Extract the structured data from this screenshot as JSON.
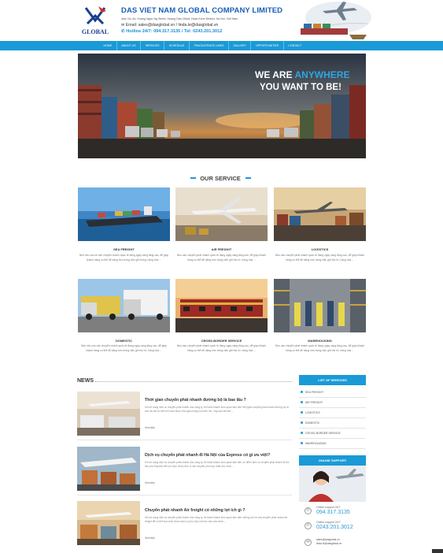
{
  "header": {
    "company_name": "DAS VIET NAM GLOBAL COMPANY LIMITED",
    "address": "Add: No 4A, Hoang Ngoc Ng Street, Hoang Dieu Ward, Hoan Kiem District, Ha Noi, Viet Nam",
    "email_line": "Email: sales@dasglobal.vn / linda.le@dasglobal.vn",
    "hotline_line": "Hotline 24/7: 094.317.3135 / Tel: 0243.201.3012",
    "logo_text": "GLOBAL"
  },
  "nav": {
    "items": [
      "HOME",
      "ABOUT US",
      "SERVICES",
      "SCHEDULE",
      "TRACK&TRACE LINKS",
      "GALLERY",
      "OPPORTUNITIES",
      "CONTACT"
    ]
  },
  "banner": {
    "line1_pre": "WE ARE ",
    "line1_hl": "ANYWHERE",
    "line2": "YOU WANT TO BE!"
  },
  "services": {
    "title": "OUR SERVICE",
    "items": [
      {
        "name": "SEA FREIGHT",
        "desc": "Nếu nhu cầu về vận chuyển nhanh quốc tế đang ngày càng tăng cao, để giúp khách hàng có thể dễ dàng hơn trong việc gửi hàng, hàng hóa ..."
      },
      {
        "name": "AIR FREIGHT",
        "desc": "Nhu cầu chuyển phát nhanh quốc tế đang ngày càng tăng cao, để giúp khách hàng có thể dễ dàng hơn trong việc gửi thư từ, hàng hóa ..."
      },
      {
        "name": "LOGISTICS",
        "desc": "Nhu cầu chuyển phát nhanh quốc tế đang ngày càng tăng cao, để giúp khách hàng có thể dễ dàng hơn trong việc gửi thư từ, hàng hóa ..."
      },
      {
        "name": "DOMESTIC",
        "desc": "Nếu nhu cầu vận chuyển nhanh quốc tế đang ngày càng tăng cao, để giúp khách hàng có thể dễ dàng hơn trong việc gửi thư từ, hàng hóa ..."
      },
      {
        "name": "CROSS-BORDER SERVICE",
        "desc": "Nhu cầu chuyển phát nhanh quốc tế đang ngày càng tăng cao, để giúp khách hàng có thể dễ dàng hơn trong việc gửi thư từ, hàng hóa ..."
      },
      {
        "name": "WAREHOUSING",
        "desc": "Nhu cầu chuyển phát nhanh quốc tế đang ngày càng tăng cao, để giúp khách hàng có thể dễ dàng hơn trong việc gửi thư từ, hàng hóa ..."
      }
    ]
  },
  "news": {
    "title": "NEWS",
    "items": [
      {
        "title": "Thời gian chuyển phát nhanh đường bộ là bao lâu ?",
        "desc": "Khi sử dụng dịch vụ chuyển phát nhanh của công ty, thì hành khách luôn quan tâm đến thời gian chuyển phát nhanh đường bộ là bao lâu để có thể tính toán được thời gian hàng hóa đến nơi. Vậy bạn đã biết ...",
        "more": "Xem tiếp"
      },
      {
        "title": "Dịch vụ chuyển phát nhanh đi Hà Nội của Express có gì ưu việt?",
        "desc": "Khi sử dụng dịch vụ chuyển phát nhanh của công ty, thì hành khách luôn quan tâm đến ưu điểm dịch vụ chuyển phát nhanh đi Hà Nội của Express để lựa chọn được đơn vị vận chuyển phù hợp nhất cho mình ...",
        "more": "Xem tiếp"
      },
      {
        "title": "Chuyển phát nhanh Air freight có những lợi ích gì ?",
        "desc": "Khi sử dụng dịch vụ chuyển phát nhanh của công ty, thì hành khách luôn quan tâm đến những lợi ích của chuyển phát nhanh Air freight để có thể lựa chọn được dịch vụ phù hợp với nhu cầu của mình ...",
        "more": "Xem tiếp"
      }
    ]
  },
  "sidebar": {
    "services_title": "LIST OF SERVICES",
    "services": [
      "SEA FREIGHT",
      "AIR FREIGHT",
      "LOGISTICS",
      "DOMESTIC",
      "CROSS-BORDER SERVICE",
      "WAREHOUSING"
    ],
    "support_title": "ONLINE SUPPORT",
    "support1_label": "Online support 24/7",
    "support1_phone": "094.317.3135",
    "support2_label": "Online support 24/7",
    "support2_phone": "0243.201.3012",
    "email1": "sales@dasglobal.vn",
    "email2": "linda.le@dasglobal.vn"
  }
}
